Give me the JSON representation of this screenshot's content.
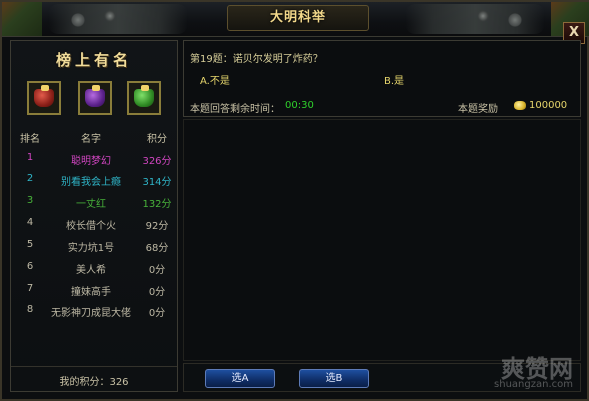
{
  "window": {
    "title": "大明科举",
    "close_label": "X"
  },
  "leaderboard": {
    "title": "榜上有名",
    "columns": {
      "rank": "排名",
      "name": "名字",
      "score": "积分"
    },
    "rows": [
      {
        "rank": "1",
        "name": "聪明梦幻",
        "score": "326分"
      },
      {
        "rank": "2",
        "name": "别看我会上瘾",
        "score": "314分"
      },
      {
        "rank": "3",
        "name": "一丈红",
        "score": "132分"
      },
      {
        "rank": "4",
        "name": "校长借个火",
        "score": "92分"
      },
      {
        "rank": "5",
        "name": "实力坑1号",
        "score": "68分"
      },
      {
        "rank": "6",
        "name": "美人希",
        "score": "0分"
      },
      {
        "rank": "7",
        "name": "撞妹高手",
        "score": "0分"
      },
      {
        "rank": "8",
        "name": "无影神刀成昆大佬",
        "score": "0分"
      }
    ],
    "my_score": "我的积分：326"
  },
  "question": {
    "text": "第19题：诺贝尔发明了炸药？",
    "option_a": "A.不是",
    "option_b": "B.是",
    "time_label": "本题回答剩余时间：",
    "time_value": "00:30",
    "reward_label": "本题奖励",
    "reward_value": "100000"
  },
  "buttons": {
    "choose_a": "选A",
    "choose_b": "选B"
  },
  "watermark": {
    "cn": "爽赞网",
    "en": "shuangzan.com"
  }
}
